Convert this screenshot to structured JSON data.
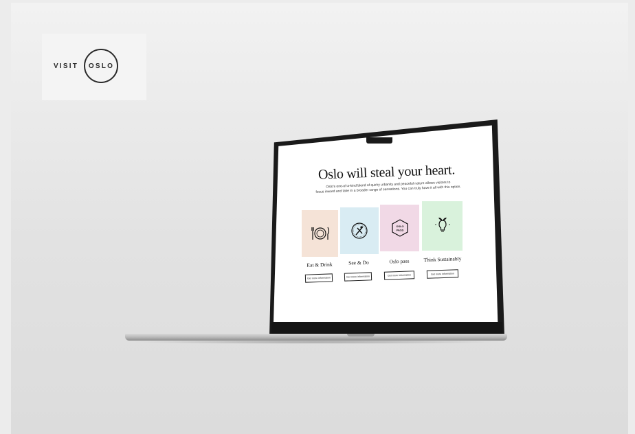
{
  "logo": {
    "word": "VISIT",
    "ring_text": "OSLO"
  },
  "screen": {
    "title": "Oslo will steal your heart.",
    "subtitle_line1": "Oslo's one-of-a-kind blend of quirky urbanity and peaceful nature allows visitors to",
    "subtitle_line2": "focus inward and take in a broader range of sensations. You can truly have it all with this option.",
    "cards": [
      {
        "label": "Eat & Drink",
        "button": "Get more information",
        "color": "#f5e3d7",
        "icon": "plate-fork-knife-icon"
      },
      {
        "label": "See & Do",
        "button": "Get more information",
        "color": "#d9ecf3",
        "icon": "activity-badge-icon"
      },
      {
        "label": "Oslo pass",
        "button": "Get more information",
        "color": "#f1d9e6",
        "icon": "oslo-pass-icon",
        "icon_text": "OSLO PASS"
      },
      {
        "label": "Think Sustainably",
        "button": "Get more information",
        "color": "#d9f2dc",
        "icon": "lightbulb-leaf-icon"
      }
    ]
  }
}
